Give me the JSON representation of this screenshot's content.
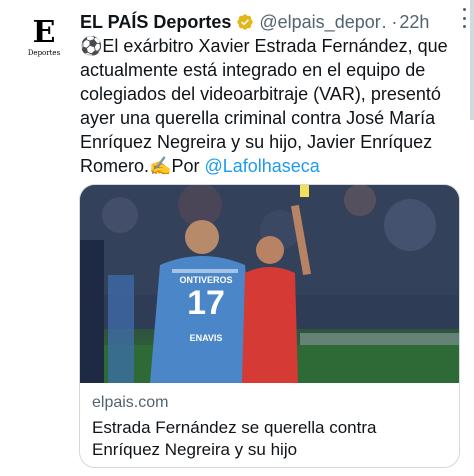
{
  "account": {
    "avatar_letter": "E",
    "avatar_sub": "Deportes",
    "name": "EL PAÍS Deportes",
    "handle": "@elpais_depor…",
    "separator": "·",
    "time": "22h"
  },
  "tweet": {
    "emoji": "⚽",
    "body": "El exárbitro Xavier Estrada Fernández, que actualmente está integrado en el equipo de colegiados del videoarbitraje (VAR), presentó ayer una querella criminal contra José María Enríquez Negreira y su hijo, Javier Enríquez Romero.",
    "writing_emoji": "✍️",
    "by": "Por ",
    "mention": "@Lafolhaseca"
  },
  "card": {
    "image_alt": "Referee showing a yellow card to a Málaga player",
    "shirt_name": "ONTIVEROS",
    "shirt_number": "17",
    "shirt_sponsor": "ENAVIS",
    "domain": "elpais.com",
    "title": "Estrada Fernández se querella contra Enríquez Negreira y su hijo"
  },
  "colors": {
    "link": "#1d9bf0",
    "secondary_text": "#536471",
    "verified_gold": "#e2b719",
    "border": "#cfd9de"
  },
  "icons": {
    "verified": "verified-gold-badge-icon",
    "more": "more-options-icon"
  }
}
